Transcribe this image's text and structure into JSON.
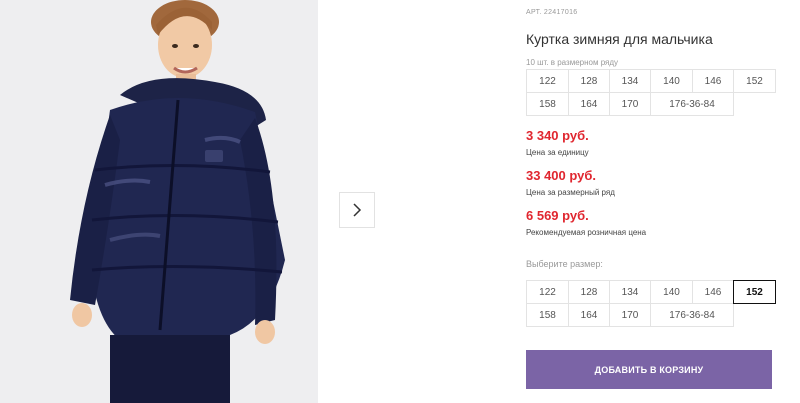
{
  "product": {
    "article": "АРТ. 22417016",
    "title": "Куртка зимняя для мальчика",
    "pack_label": "10 шт. в размерном ряду",
    "pack_sizes": [
      "122",
      "128",
      "134",
      "140",
      "146",
      "152",
      "158",
      "164",
      "170",
      "176-36-84"
    ],
    "prices": [
      {
        "value": "3 340 руб.",
        "note": "Цена за единицу"
      },
      {
        "value": "33 400 руб.",
        "note": "Цена за размерный ряд"
      },
      {
        "value": "6 569 руб.",
        "note": "Рекомендуемая розничная цена"
      }
    ],
    "choose_label": "Выберите размер:",
    "choose_sizes": [
      "122",
      "128",
      "134",
      "140",
      "146",
      "152",
      "158",
      "164",
      "170",
      "176-36-84"
    ],
    "selected_size": "152",
    "add_to_cart_label": "ДОБАВИТЬ В КОРЗИНУ"
  },
  "gallery": {
    "next_icon": "chevron-right-icon"
  },
  "colors": {
    "accent": "#7b64a6",
    "price": "#e0262f",
    "jacket": "#1e2448"
  }
}
